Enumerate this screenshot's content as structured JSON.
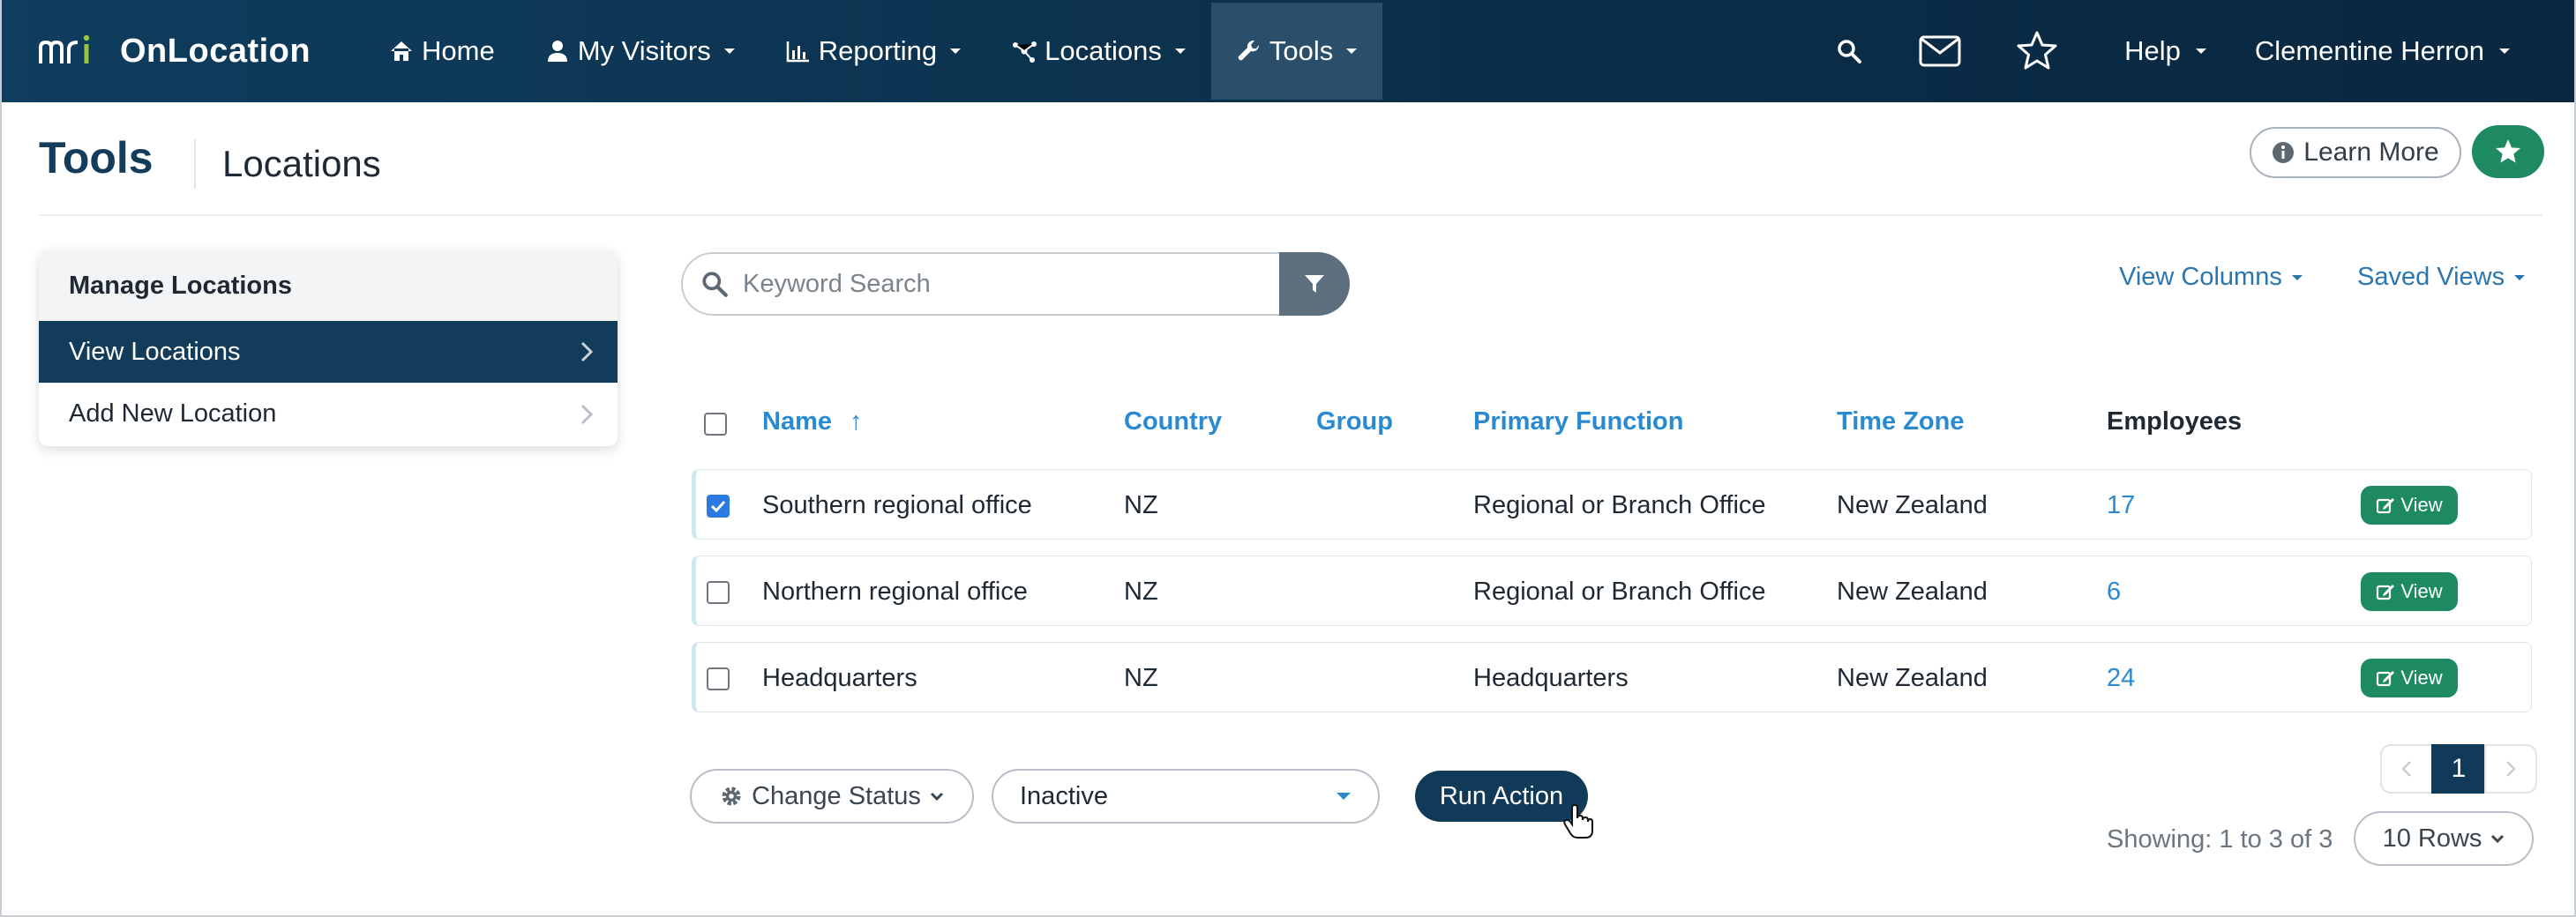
{
  "brand": {
    "name": "OnLocation",
    "logo_text": "mri"
  },
  "nav": {
    "items": [
      {
        "label": "Home",
        "icon": "home-icon"
      },
      {
        "label": "My Visitors",
        "icon": "user-icon"
      },
      {
        "label": "Reporting",
        "icon": "bar-chart-icon"
      },
      {
        "label": "Locations",
        "icon": "network-icon"
      },
      {
        "label": "Tools",
        "icon": "wrench-icon",
        "active": true
      }
    ],
    "help_label": "Help",
    "user_name": "Clementine Herron",
    "right_icons": [
      "search-icon",
      "mail-icon",
      "star-icon"
    ]
  },
  "header": {
    "title": "Tools",
    "subtitle": "Locations",
    "learn_more": "Learn More"
  },
  "sidebar": {
    "heading": "Manage Locations",
    "items": [
      {
        "label": "View Locations",
        "active": true
      },
      {
        "label": "Add New Location",
        "active": false
      }
    ]
  },
  "search": {
    "placeholder": "Keyword Search",
    "value": ""
  },
  "toolbar": {
    "view_columns": "View Columns",
    "saved_views": "Saved Views"
  },
  "table": {
    "columns": [
      "Name",
      "Country",
      "Group",
      "Primary Function",
      "Time Zone",
      "Employees"
    ],
    "sort_indicator": "↑",
    "rows": [
      {
        "name": "Southern regional office",
        "country": "NZ",
        "group": "",
        "primary_function": "Regional or Branch Office",
        "time_zone": "New Zealand",
        "employees": "17",
        "checked": true
      },
      {
        "name": "Northern regional office",
        "country": "NZ",
        "group": "",
        "primary_function": "Regional or Branch Office",
        "time_zone": "New Zealand",
        "employees": "6",
        "checked": false
      },
      {
        "name": "Headquarters",
        "country": "NZ",
        "group": "",
        "primary_function": "Headquarters",
        "time_zone": "New Zealand",
        "employees": "24",
        "checked": false
      }
    ],
    "view_label": "View"
  },
  "actions": {
    "change_status": "Change Status",
    "status_value": "Inactive",
    "run_action": "Run Action"
  },
  "pagination": {
    "current_page": "1",
    "showing": "Showing: 1 to 3 of 3",
    "rows_label": "10 Rows"
  },
  "colors": {
    "nav_bg": "#0f3d5e",
    "accent_dark": "#103a57",
    "link": "#2a8ad1",
    "success": "#1e8a62",
    "logo_green": "#9bc53d"
  }
}
